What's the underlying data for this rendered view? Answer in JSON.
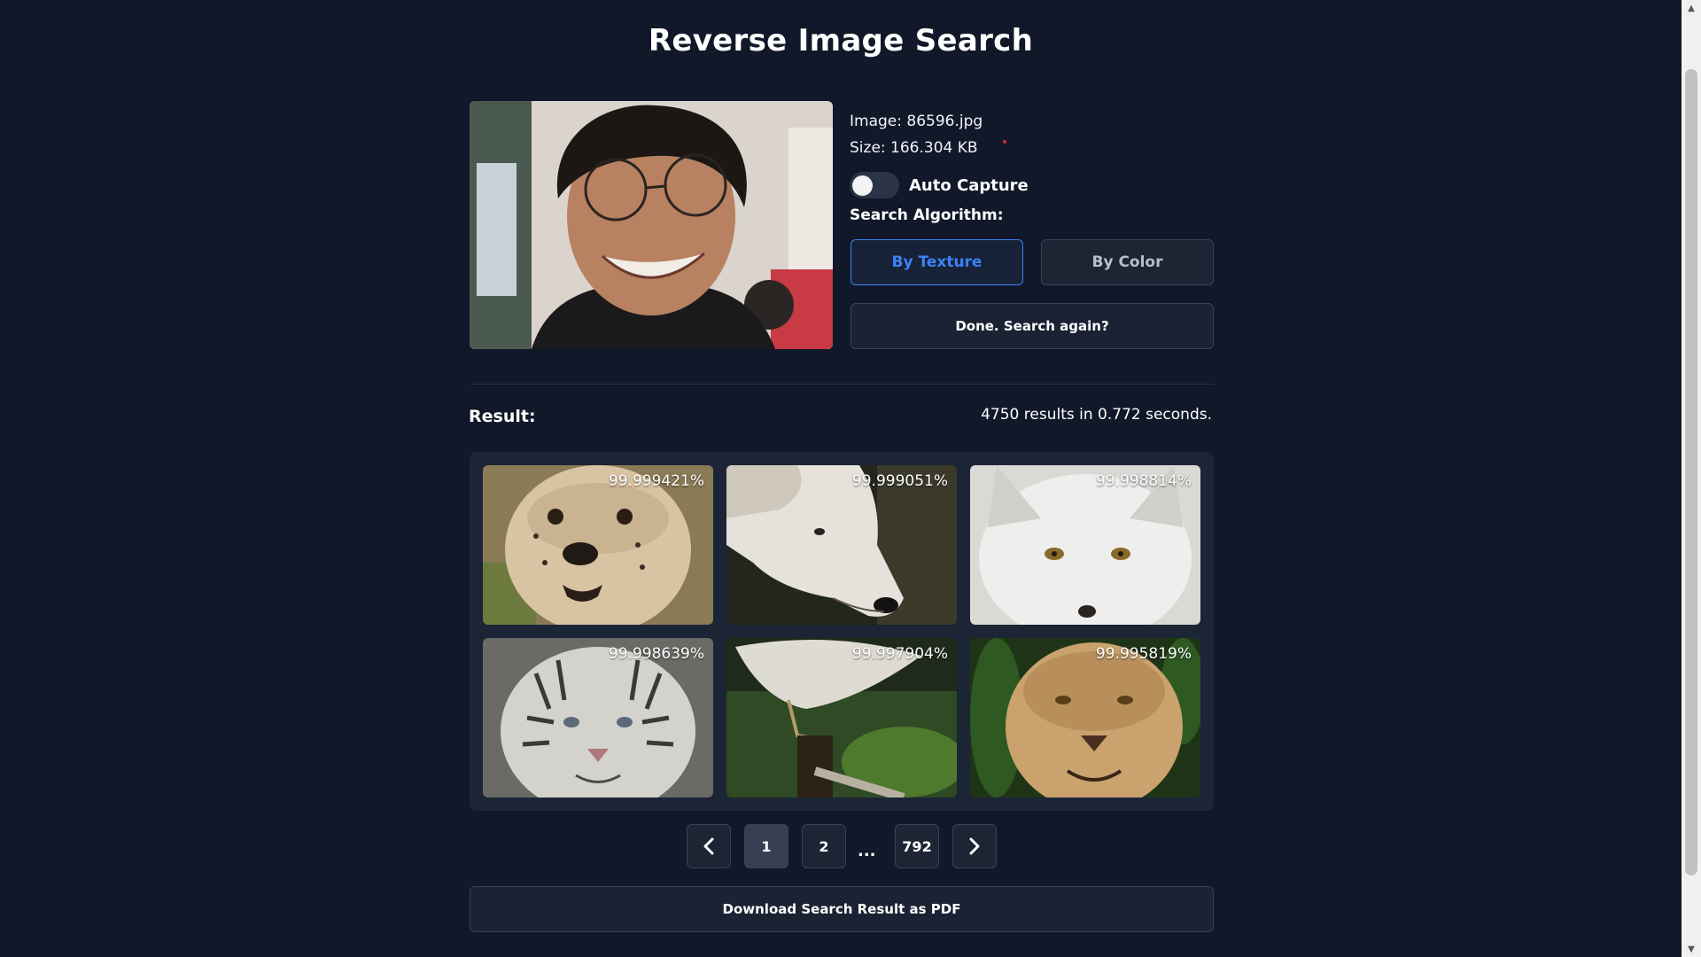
{
  "page": {
    "title": "Reverse Image Search"
  },
  "query": {
    "image_line": "Image: 86596.jpg",
    "size_line": "Size: 166.304 KB",
    "auto_capture": {
      "label": "Auto Capture",
      "enabled": false
    },
    "algorithm_label": "Search Algorithm:",
    "algorithm_options": [
      {
        "label": "By Texture",
        "selected": true
      },
      {
        "label": "By Color",
        "selected": false
      }
    ],
    "search_again_label": "Done. Search again?"
  },
  "results": {
    "heading": "Result:",
    "summary": "4750 results in 0.772 seconds.",
    "items": [
      {
        "score": "99.999421%",
        "subject": "cheetah cub"
      },
      {
        "score": "99.999051%",
        "subject": "white wolf"
      },
      {
        "score": "99.998814%",
        "subject": "arctic fox"
      },
      {
        "score": "99.998639%",
        "subject": "white tiger"
      },
      {
        "score": "99.997904%",
        "subject": "bird on branch"
      },
      {
        "score": "99.995819%",
        "subject": "lioness"
      }
    ]
  },
  "pagination": {
    "prev_icon": "chevron-left-icon",
    "pages": [
      "1",
      "2",
      "792"
    ],
    "current": "1",
    "ellipsis": "...",
    "next_icon": "chevron-right-icon"
  },
  "download_label": "Download Search Result as PDF",
  "colors": {
    "background": "#101829",
    "panel": "#1c2535",
    "accent": "#3b82f6",
    "button_border": "#3a4356"
  }
}
